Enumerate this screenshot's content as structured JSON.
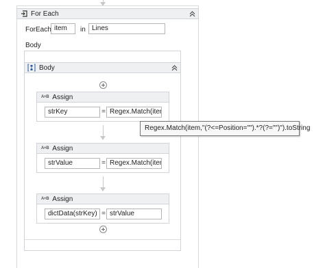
{
  "foreach": {
    "title": "For Each",
    "foreach_label": "ForEach",
    "item_value": "item",
    "in_label": "in",
    "collection_value": "Lines",
    "body_label": "Body"
  },
  "body": {
    "title": "Body"
  },
  "assigns": [
    {
      "title": "Assign",
      "to": "strKey",
      "value": "Regex.Match(item,"
    },
    {
      "title": "Assign",
      "to": "strValue",
      "value": "Regex.Match(item,"
    },
    {
      "title": "Assign",
      "to": "dictData(strKey)",
      "value": "strValue"
    }
  ],
  "equals_sign": "=",
  "assign_icon_text": "A+B",
  "tooltip": {
    "text": "Regex.Match(item,\"(?<=Position=\"\").*?(?=\"\")\").toString"
  },
  "colors": {
    "header_bg": "#eef0f2",
    "border": "#d0d4d8",
    "tooltip_border": "#767676"
  }
}
